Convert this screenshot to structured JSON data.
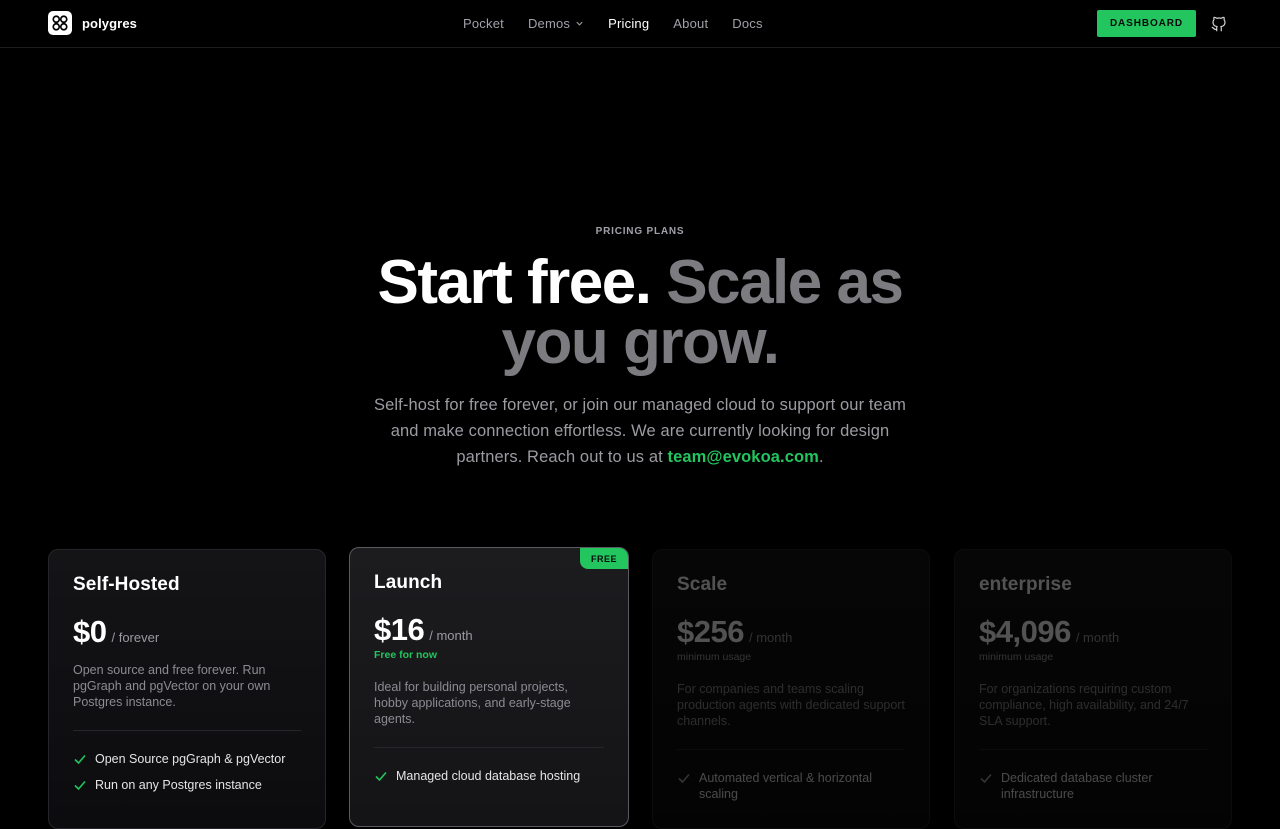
{
  "nav": {
    "brand": "polygres",
    "links": [
      "Pocket",
      "Demos",
      "Pricing",
      "About",
      "Docs"
    ],
    "active": "Pricing",
    "dashboard_label": "DASHBOARD"
  },
  "hero": {
    "eyebrow": "PRICING PLANS",
    "headline_bright": "Start free.",
    "headline_dim": "Scale as you grow.",
    "sub_text": "Self-host for free forever, or join our managed cloud to support our team and make connection effortless. We are currently looking for design partners. Reach out to us at",
    "email": "team@evokoa.com",
    "sub_end": "."
  },
  "plans": [
    {
      "title": "Self-Hosted",
      "price": "$0",
      "period": "/ forever",
      "note": "",
      "desc": "Open source and free forever. Run pgGraph and pgVector on your own Postgres instance.",
      "features": [
        "Open Source pgGraph & pgVector",
        "Run on any Postgres instance"
      ]
    },
    {
      "title": "Launch",
      "badge": "FREE",
      "price": "$16",
      "period": "/ month",
      "note": "Free for now",
      "desc": "Ideal for building personal projects, hobby applications, and early-stage agents.",
      "features": [
        "Managed cloud database hosting"
      ]
    },
    {
      "title": "Scale",
      "price": "$256",
      "period": "/ month",
      "note": "minimum usage",
      "desc": "For companies and teams scaling production agents with dedicated support channels.",
      "features": [
        "Automated vertical & horizontal scaling"
      ]
    },
    {
      "title": "enterprise",
      "price": "$4,096",
      "period": "/ month",
      "note": "minimum usage",
      "desc": "For organizations requiring custom compliance, high availability, and 24/7 SLA support.",
      "features": [
        "Dedicated database cluster infrastructure"
      ]
    }
  ],
  "colors": {
    "accent": "#22c55e",
    "background": "#000000",
    "muted_text": "#9b9ba2"
  },
  "icons": [
    "polygres-logo-icon",
    "chevron-down-icon",
    "github-icon",
    "check-icon"
  ]
}
